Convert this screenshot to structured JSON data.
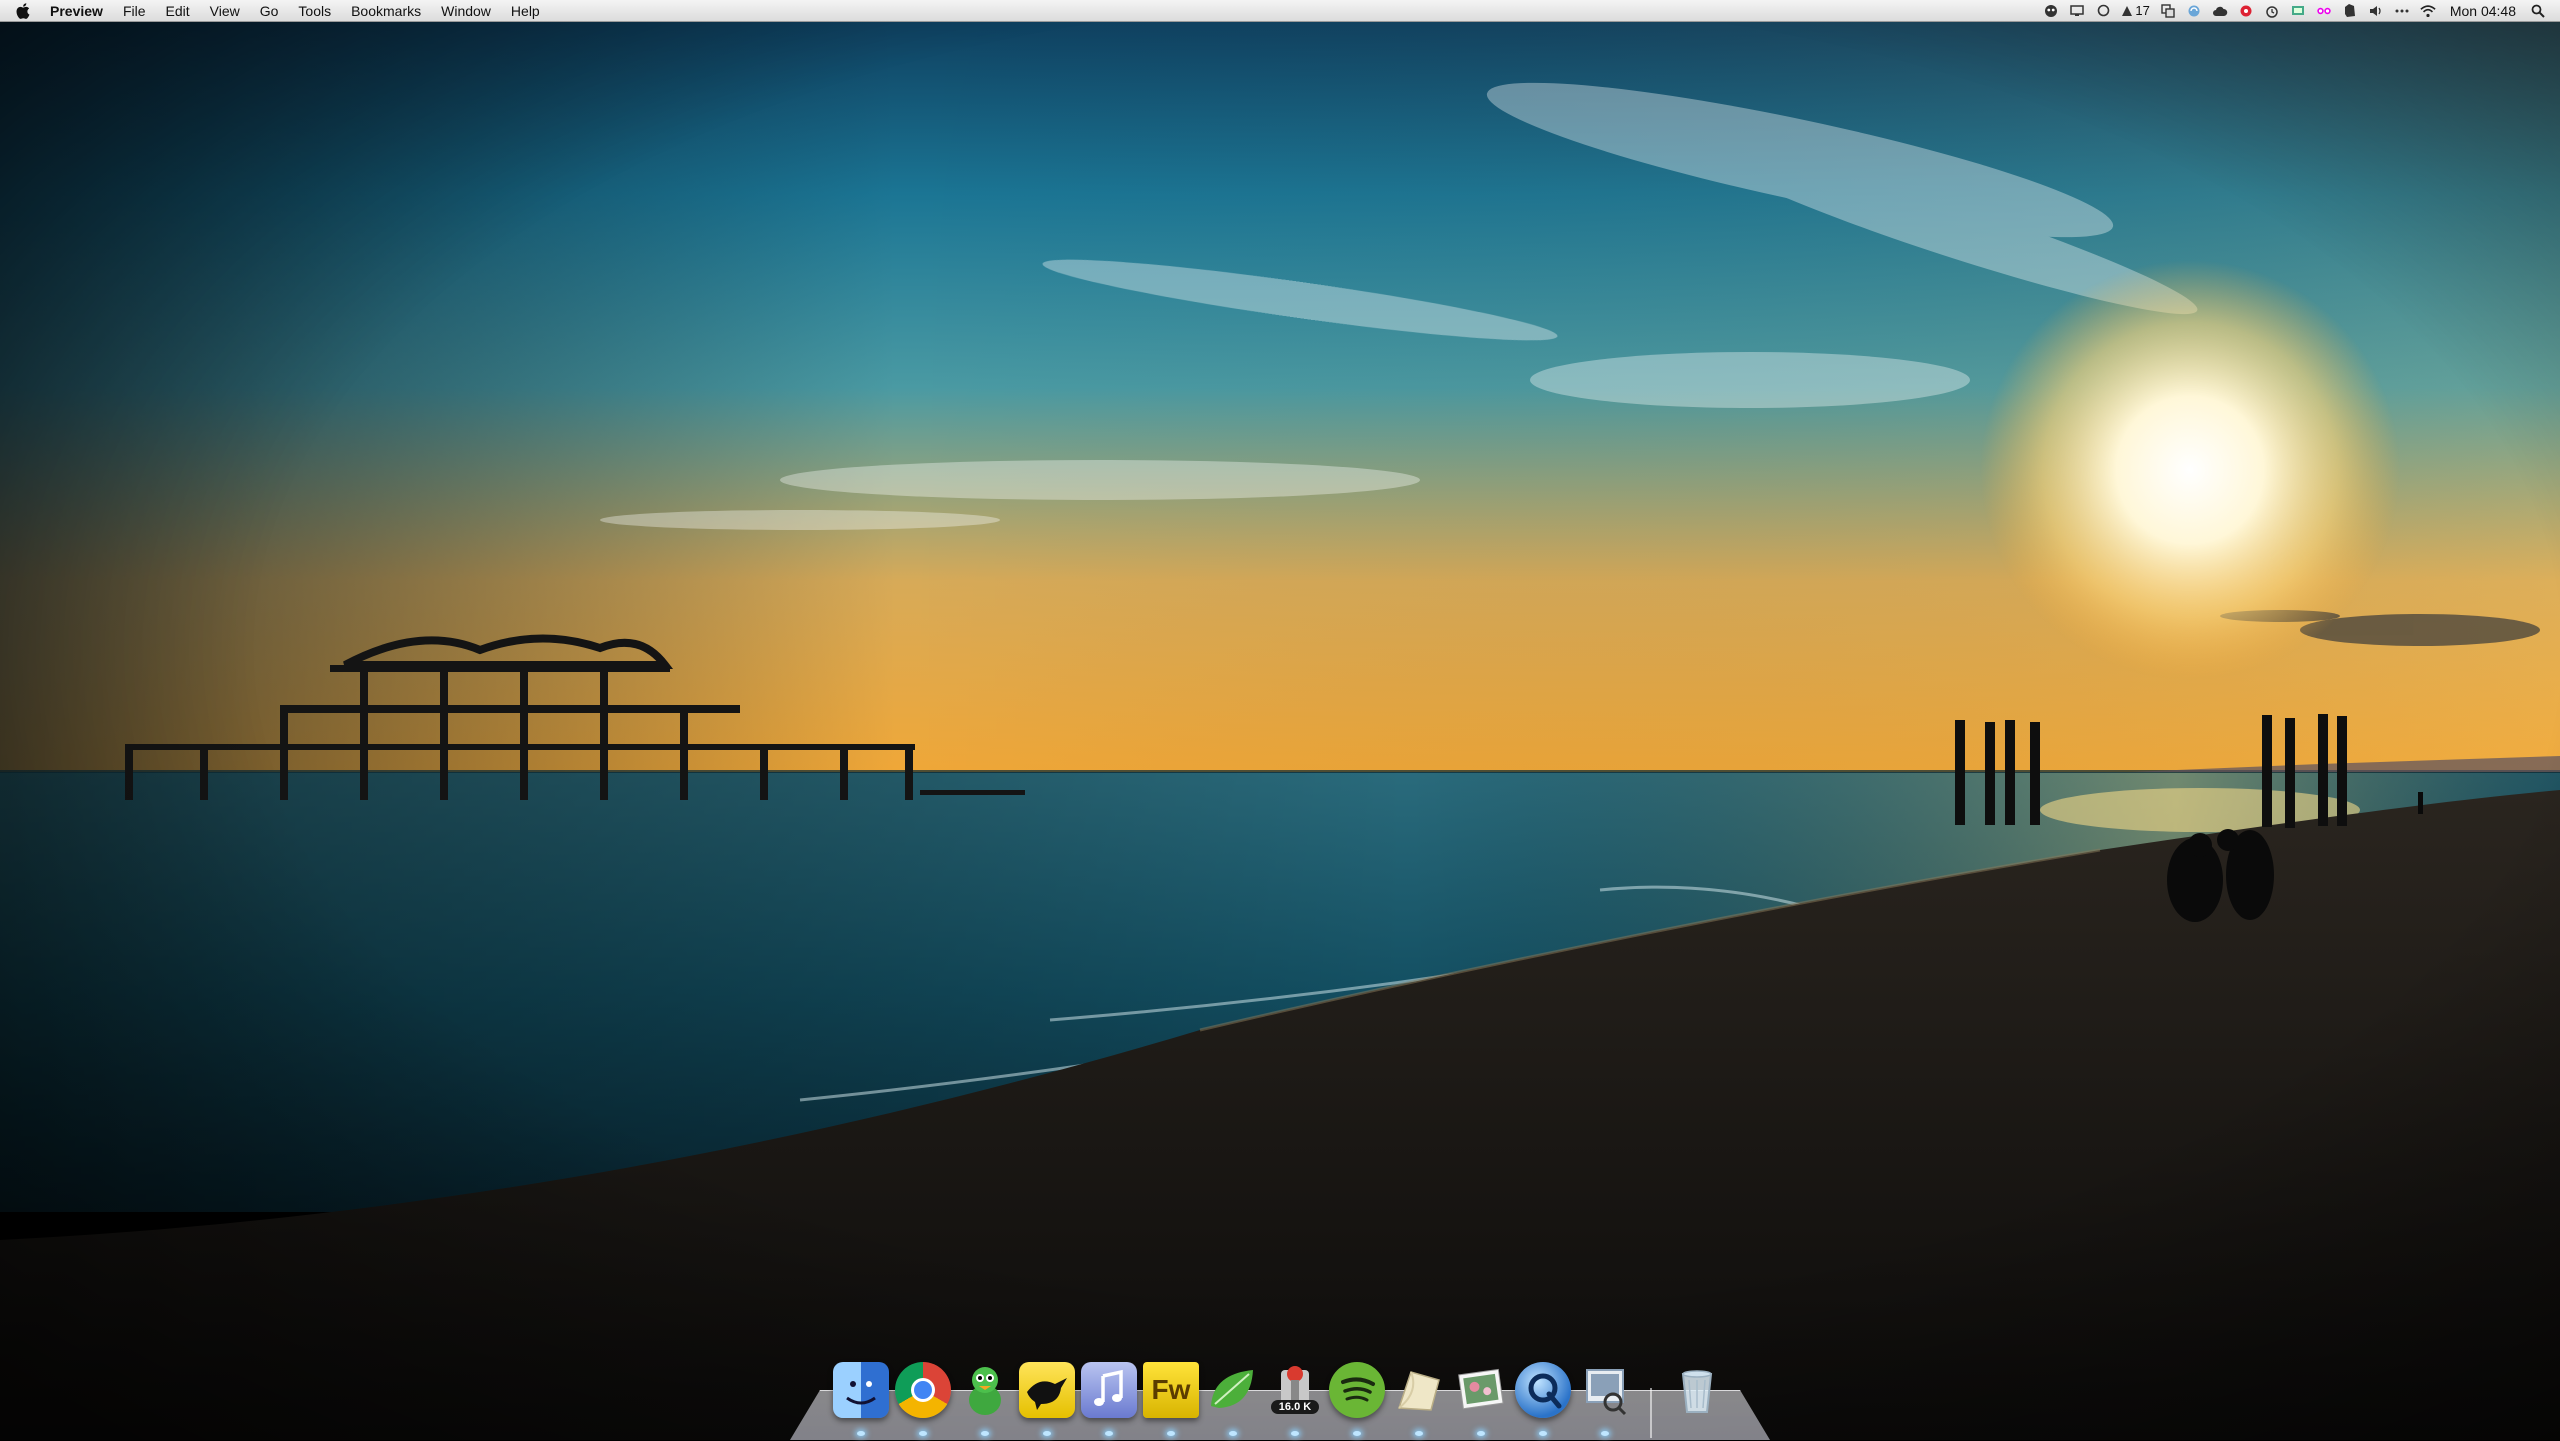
{
  "menubar": {
    "app_name": "Preview",
    "menus": [
      "File",
      "Edit",
      "View",
      "Go",
      "Tools",
      "Bookmarks",
      "Window",
      "Help"
    ],
    "extras": [
      {
        "name": "alien-icon"
      },
      {
        "name": "display-icon"
      },
      {
        "name": "sync-icon"
      },
      {
        "name": "cloud-icon"
      },
      {
        "name": "alarm-icon"
      },
      {
        "name": "volume-icon"
      },
      {
        "name": "wifi-icon"
      }
    ],
    "status_count": "17",
    "clock": "Mon 04:48"
  },
  "dock": {
    "apps": [
      {
        "name": "finder-icon",
        "color": "#3d7fd6"
      },
      {
        "name": "chrome-icon",
        "color": "#db4437"
      },
      {
        "name": "adium-icon",
        "color": "#3fa83f"
      },
      {
        "name": "tweetie-icon",
        "color": "#f2d21d"
      },
      {
        "name": "itunes-icon",
        "color": "#7b8cd6"
      },
      {
        "name": "fireworks-icon",
        "label": "Fw",
        "color": "#d8b400"
      },
      {
        "name": "evernote-icon",
        "color": "#4caf3a"
      },
      {
        "name": "transmission-icon",
        "badge": "16.0 K",
        "color": "#d93a2f"
      },
      {
        "name": "spotify-icon",
        "color": "#6ab635"
      },
      {
        "name": "notes-icon",
        "color": "#efe7c7"
      },
      {
        "name": "preview-photo-icon",
        "color": "#6a9a6a"
      },
      {
        "name": "quicktime-icon",
        "color": "#2b73c9"
      },
      {
        "name": "photo-tool-icon",
        "color": "#8aa0b8"
      }
    ],
    "trash": {
      "name": "trash-icon"
    }
  }
}
